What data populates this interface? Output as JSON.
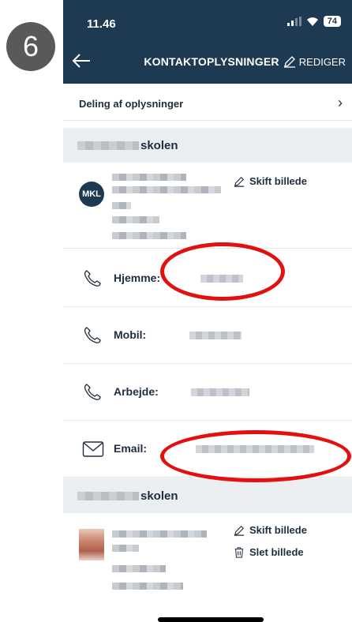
{
  "step_badge": "6",
  "status_bar": {
    "time": "11.46",
    "battery": "74"
  },
  "header": {
    "title": "KONTAKTOPLYSNINGER",
    "edit_label": "REDIGER"
  },
  "sharing_link": {
    "label": "Deling af oplysninger",
    "chevron": "›"
  },
  "school1": {
    "suffix": "skolen"
  },
  "profile1": {
    "initials": "MKL",
    "change_photo": "Skift billede"
  },
  "contacts": [
    {
      "label": "Hjemme:",
      "icon": "phone-icon"
    },
    {
      "label": "Mobil:",
      "icon": "phone-icon"
    },
    {
      "label": "Arbejde:",
      "icon": "phone-icon"
    },
    {
      "label": "Email:",
      "icon": "mail-icon"
    }
  ],
  "school2": {
    "suffix": "skolen"
  },
  "profile2": {
    "change_photo": "Skift billede",
    "delete_photo": "Slet billede"
  },
  "colors": {
    "header_bg": "#1e3a52",
    "section_bg": "#eaeef1",
    "highlight": "#e31010"
  }
}
